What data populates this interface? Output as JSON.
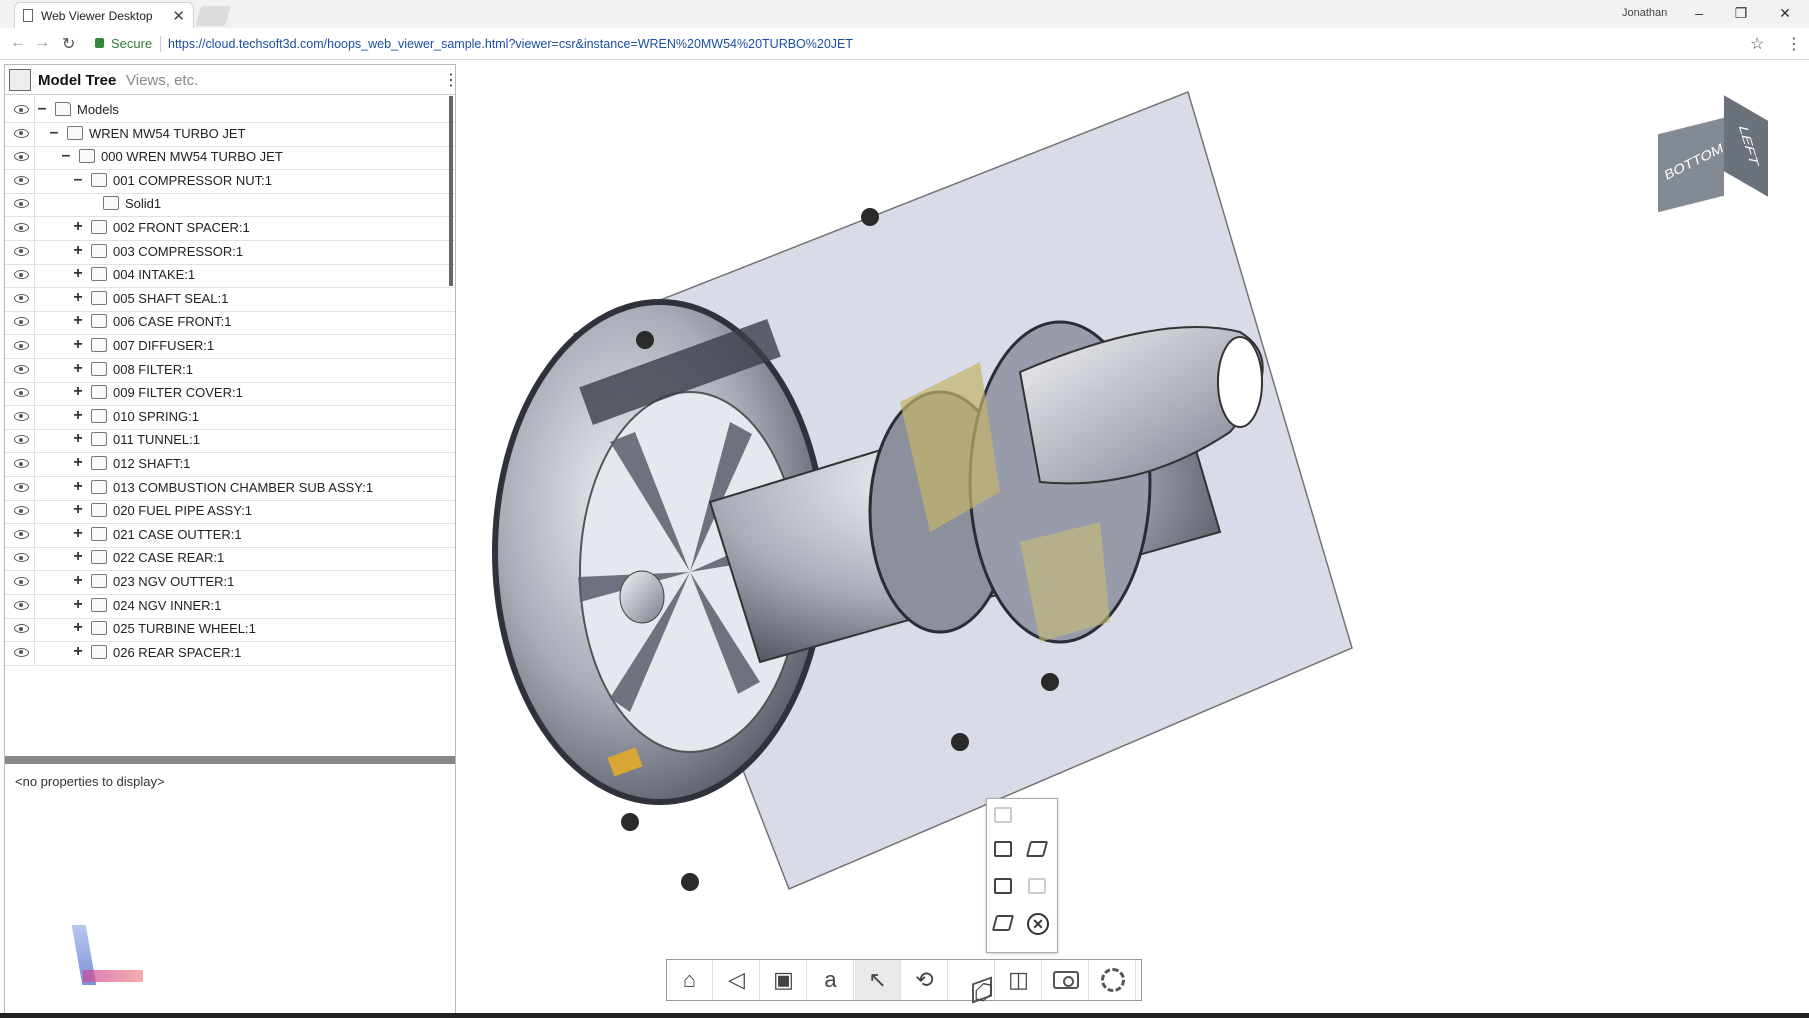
{
  "browser": {
    "tab_title": "Web Viewer Desktop",
    "tab_close": "✕",
    "user": "Jonathan",
    "minimize": "–",
    "restore": "❐",
    "close": "✕",
    "back": "←",
    "forward": "→",
    "reload": "↻",
    "secure_label": "Secure",
    "url": "https://cloud.techsoft3d.com/hoops_web_viewer_sample.html?viewer=csr&instance=WREN%20MW54%20TURBO%20JET",
    "bookmark": "☆",
    "menu": "⋮"
  },
  "panel": {
    "tab_model_tree": "Model Tree",
    "tab_views": "Views, etc.",
    "menu": "⋮",
    "no_properties": "<no properties to display>"
  },
  "tree": [
    {
      "label": "Models",
      "expander": "–",
      "depth": 0,
      "icon": "folder-icon"
    },
    {
      "label": "WREN MW54 TURBO JET",
      "expander": "–",
      "depth": 1,
      "icon": "assembly-icon"
    },
    {
      "label": "000 WREN MW54 TURBO JET",
      "expander": "–",
      "depth": 2,
      "icon": "assembly-icon"
    },
    {
      "label": "001 COMPRESSOR NUT:1",
      "expander": "–",
      "depth": 3,
      "icon": "assembly-icon"
    },
    {
      "label": "Solid1",
      "expander": "",
      "depth": 4,
      "icon": "solid-icon"
    },
    {
      "label": "002 FRONT SPACER:1",
      "expander": "+",
      "depth": 3,
      "icon": "assembly-icon"
    },
    {
      "label": "003 COMPRESSOR:1",
      "expander": "+",
      "depth": 3,
      "icon": "assembly-icon"
    },
    {
      "label": "004 INTAKE:1",
      "expander": "+",
      "depth": 3,
      "icon": "assembly-icon"
    },
    {
      "label": "005 SHAFT SEAL:1",
      "expander": "+",
      "depth": 3,
      "icon": "assembly-icon"
    },
    {
      "label": "006 CASE FRONT:1",
      "expander": "+",
      "depth": 3,
      "icon": "assembly-icon"
    },
    {
      "label": "007 DIFFUSER:1",
      "expander": "+",
      "depth": 3,
      "icon": "assembly-icon"
    },
    {
      "label": "008 FILTER:1",
      "expander": "+",
      "depth": 3,
      "icon": "assembly-icon"
    },
    {
      "label": "009 FILTER COVER:1",
      "expander": "+",
      "depth": 3,
      "icon": "assembly-icon"
    },
    {
      "label": "010 SPRING:1",
      "expander": "+",
      "depth": 3,
      "icon": "assembly-icon"
    },
    {
      "label": "011 TUNNEL:1",
      "expander": "+",
      "depth": 3,
      "icon": "assembly-icon"
    },
    {
      "label": "012 SHAFT:1",
      "expander": "+",
      "depth": 3,
      "icon": "assembly-icon"
    },
    {
      "label": "013 COMBUSTION CHAMBER SUB ASSY:1",
      "expander": "+",
      "depth": 3,
      "icon": "assembly-icon"
    },
    {
      "label": "020 FUEL PIPE ASSY:1",
      "expander": "+",
      "depth": 3,
      "icon": "assembly-icon"
    },
    {
      "label": "021 CASE OUTTER:1",
      "expander": "+",
      "depth": 3,
      "icon": "assembly-icon"
    },
    {
      "label": "022 CASE REAR:1",
      "expander": "+",
      "depth": 3,
      "icon": "assembly-icon"
    },
    {
      "label": "023 NGV OUTTER:1",
      "expander": "+",
      "depth": 3,
      "icon": "assembly-icon"
    },
    {
      "label": "024 NGV INNER:1",
      "expander": "+",
      "depth": 3,
      "icon": "assembly-icon"
    },
    {
      "label": "025 TURBINE WHEEL:1",
      "expander": "+",
      "depth": 3,
      "icon": "assembly-icon"
    },
    {
      "label": "026 REAR SPACER:1",
      "expander": "+",
      "depth": 3,
      "icon": "assembly-icon"
    }
  ],
  "viewer": {
    "cube_face_front": "BOTTOM",
    "cube_face_side": "LEFT",
    "cutting_close": "✕",
    "colors": {
      "accent": "#1a4fa0",
      "secure": "#2e7d32",
      "section_plane": "#d7d8e6",
      "engine_metal": "#a9adb8"
    }
  },
  "toolbar": [
    {
      "name": "home-button",
      "icon": "home-icon",
      "glyph": "⌂"
    },
    {
      "name": "camera-menu-button",
      "icon": "camera-projection-icon",
      "glyph": "◁"
    },
    {
      "name": "draw-mode-button",
      "icon": "shaded-cube-icon",
      "glyph": "▣"
    },
    {
      "name": "note-tool-button",
      "icon": "note-text-icon",
      "glyph": "a"
    },
    {
      "name": "select-button",
      "icon": "pointer-icon",
      "glyph": "↖"
    },
    {
      "name": "orbit-button",
      "icon": "orbit-icon",
      "glyph": "⟲"
    },
    {
      "name": "explode-button",
      "icon": "explode-icon",
      "glyph": "⬡"
    },
    {
      "name": "cutting-plane-button",
      "icon": "cutting-plane-icon",
      "glyph": "◫"
    },
    {
      "name": "snapshot-button",
      "icon": "camera-icon",
      "glyph": ""
    },
    {
      "name": "settings-button",
      "icon": "gear-icon",
      "glyph": ""
    }
  ]
}
